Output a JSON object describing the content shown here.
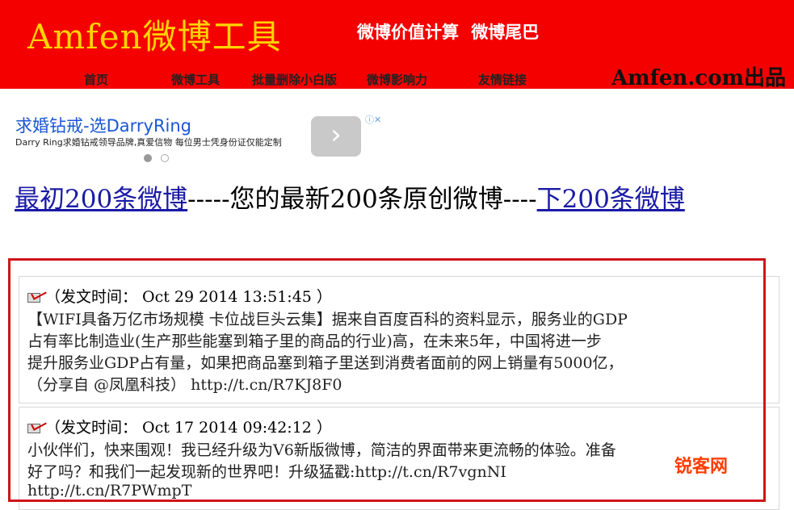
{
  "header": {
    "logo": "Amfen微博工具",
    "taglines": [
      "微博价值计算",
      "微博尾巴"
    ],
    "nav": [
      "首页",
      "微博工具",
      "批量删除小白版",
      "微博影响力",
      "友情链接"
    ],
    "brand_mark": "Amfen.com出品"
  },
  "ad": {
    "title": "求婚钻戒-选DarryRing",
    "desc": "Darry Ring求婚钻戒领导品牌,真爱信物 每位男士凭身份证仅能定制",
    "arrow_glyph": "›",
    "info_glyph": "ⓘ✕"
  },
  "page": {
    "first_link": "最初200条微博",
    "sep1": "-----",
    "middle": "您的最新200条原创微博",
    "sep2": "----",
    "next_link": "下200条微博"
  },
  "posts": [
    {
      "time": "（发文时间：  Oct 29 2014 13:51:45 ）",
      "lines": [
        "【WIFI具备万亿市场规模 卡位战巨头云集】据来自百度百科的资料显示，服务业的GDP",
        "占有率比制造业(生产那些能塞到箱子里的商品的行业)高，在未来5年，中国将进一步",
        "提升服务业GDP占有量，如果把商品塞到箱子里送到消费者面前的网上销量有5000亿，",
        "（分享自 @凤凰科技） http://t.cn/R7KJ8F0"
      ]
    },
    {
      "time": "（发文时间：  Oct 17 2014 09:42:12 ）",
      "lines": [
        "小伙伴们，快来围观！我已经升级为V6新版微博，简洁的界面带来更流畅的体验。准备",
        "好了吗？和我们一起发现新的世界吧！升级猛戳:http://t.cn/R7vgnNI",
        "http://t.cn/R7PWmpT"
      ]
    }
  ],
  "watermark": "锐客网",
  "colors": {
    "header_bg": "#f50000",
    "logo": "#ffd400",
    "link": "#1a1aa6",
    "frame": "#d0141a"
  }
}
